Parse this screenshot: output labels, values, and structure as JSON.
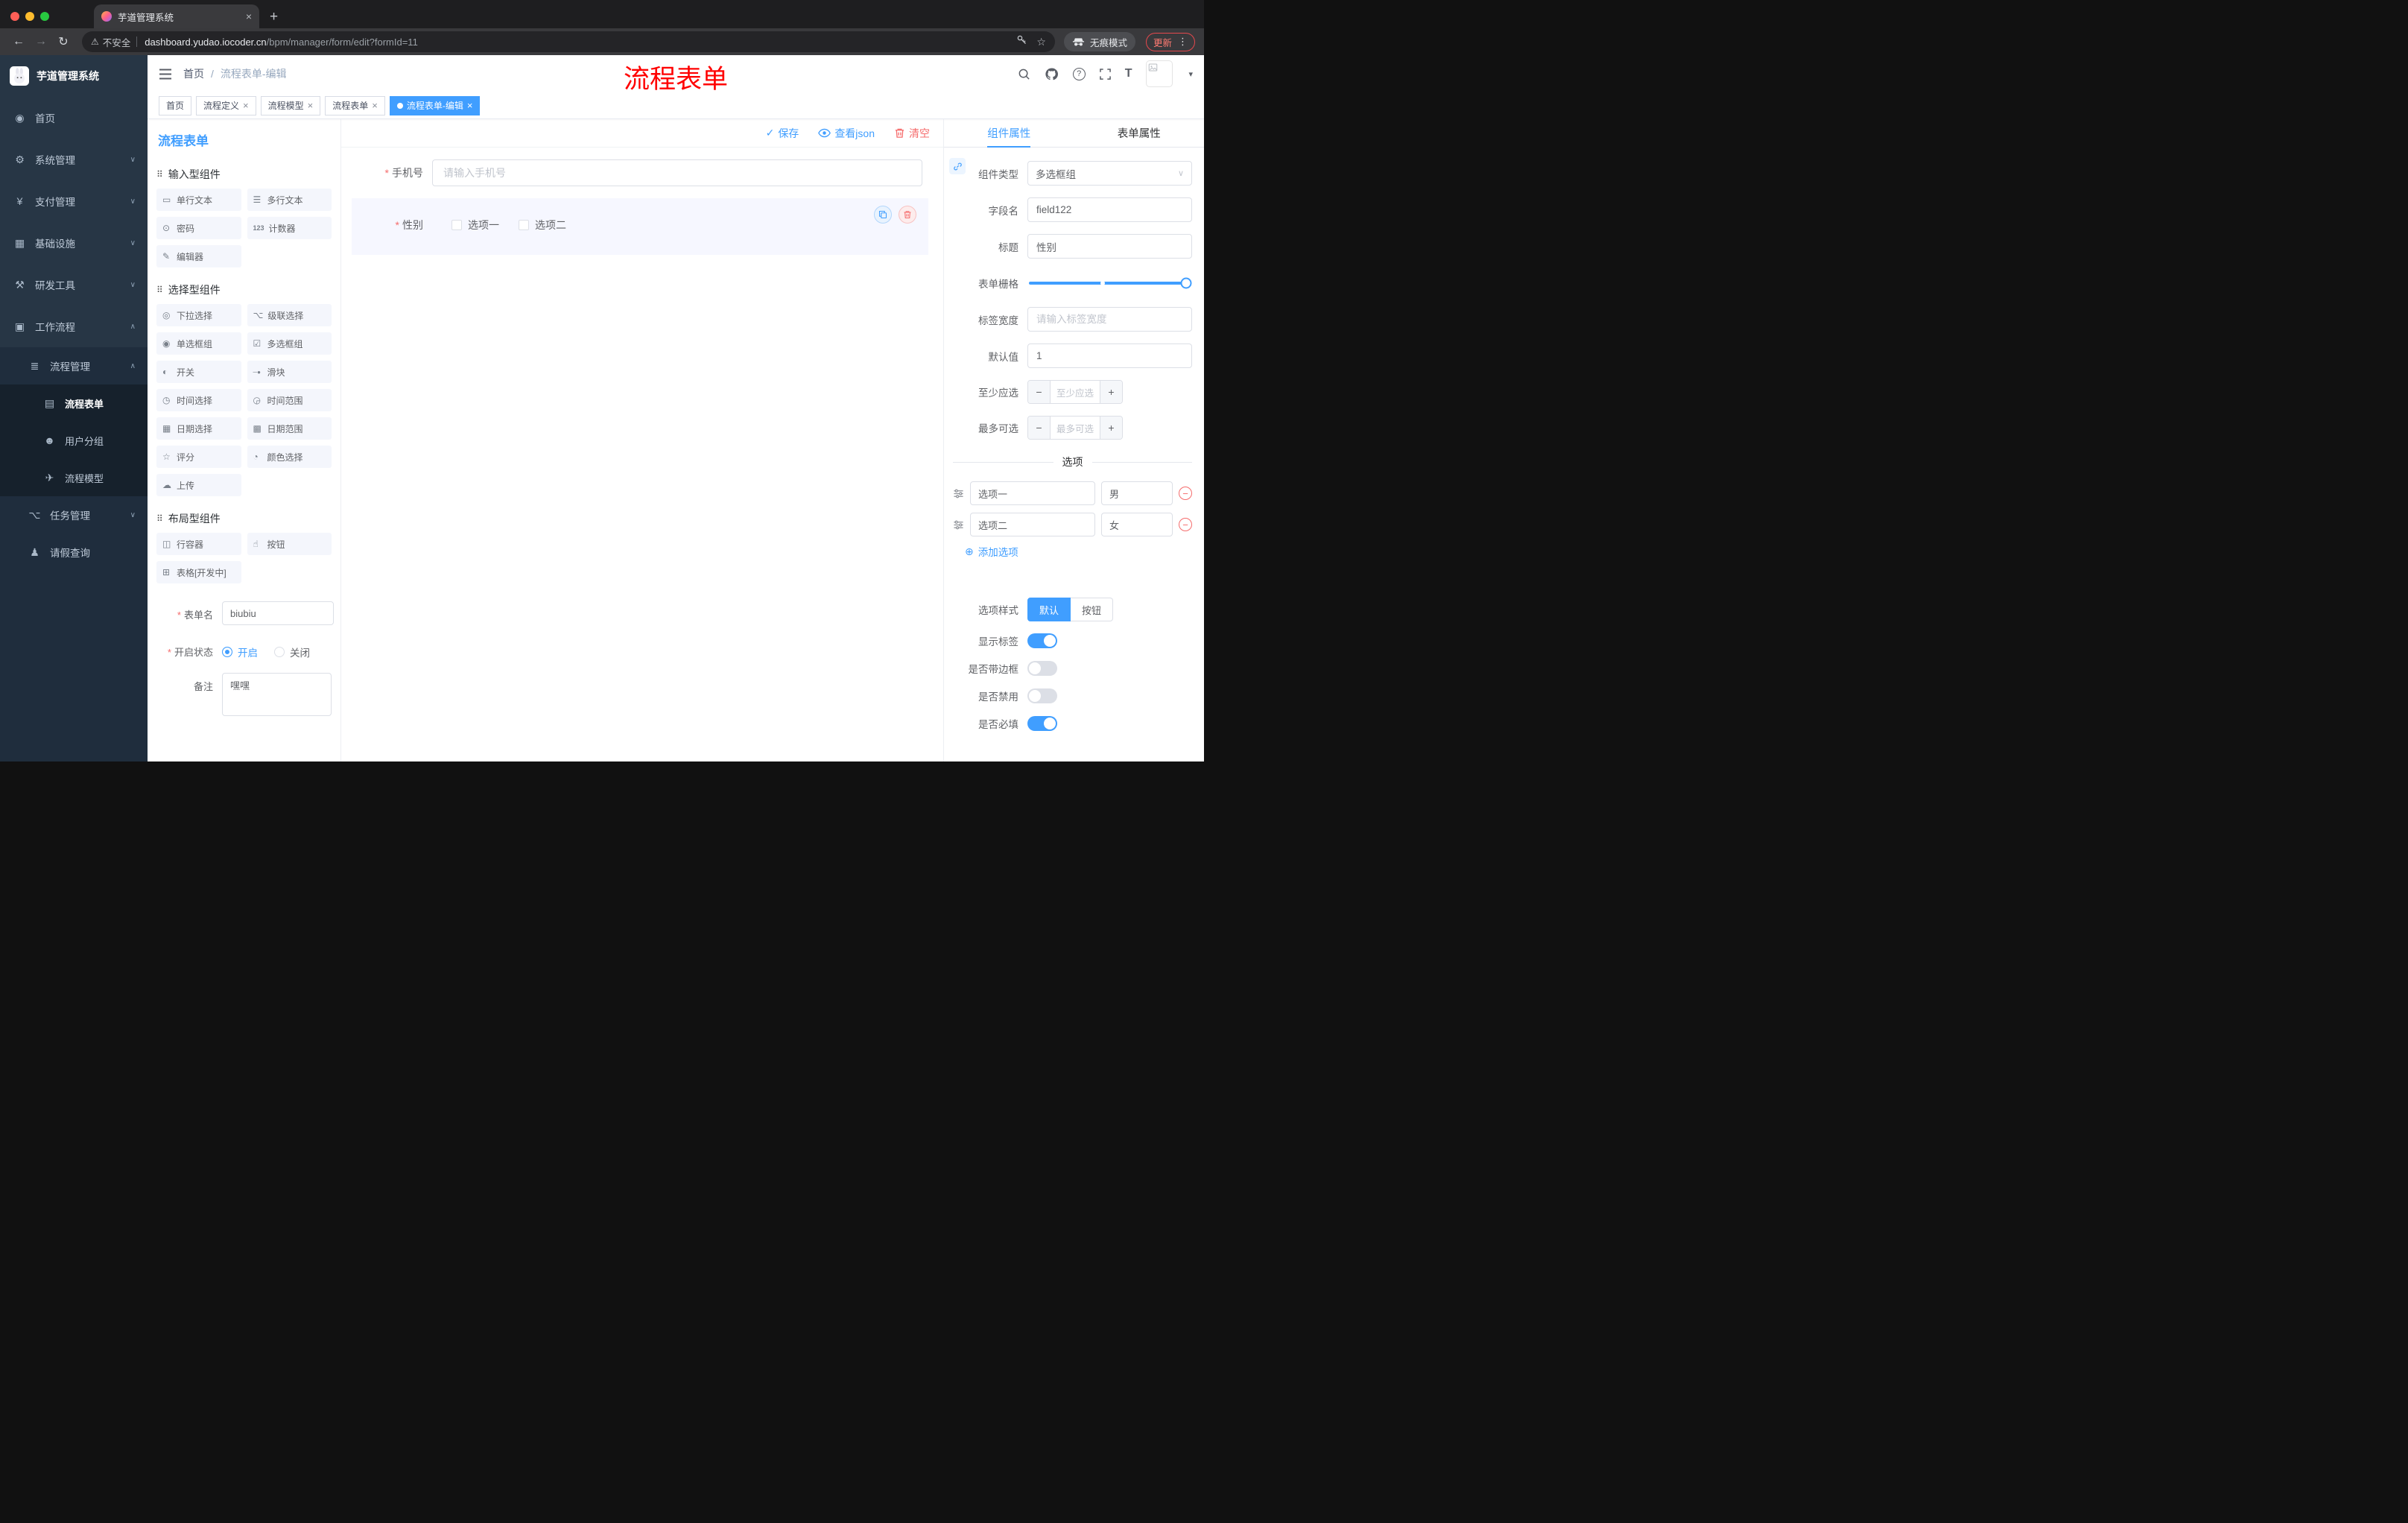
{
  "theme": {
    "primary": "#409eff",
    "danger": "#f56c6c",
    "annotation_color": "#ff0000",
    "sidebar_bg": "#273645"
  },
  "icons": {
    "back": "←",
    "forward": "→",
    "reload": "↻",
    "warning": "⚠",
    "star": "☆",
    "menu_dots": "⋮",
    "new_tab": "+",
    "close": "×",
    "caret_down": "▾",
    "check": "✓",
    "select_caret": "∨",
    "plus_circle": "⊕",
    "minus": "−",
    "plus": "+",
    "help": "?",
    "font_size": "T"
  },
  "browser": {
    "tab_title": "芋道管理系统",
    "security": "不安全",
    "url_host": "dashboard.yudao.iocoder.cn",
    "url_path": "/bpm/manager/form/edit?formId=11",
    "incognito": "无痕模式",
    "update": "更新"
  },
  "sidebar": {
    "logo": "芋道管理系统",
    "items": [
      {
        "icon": "◉",
        "label": "首页"
      },
      {
        "icon": "⚙",
        "label": "系统管理",
        "arrow": "∨"
      },
      {
        "icon": "¥",
        "label": "支付管理",
        "arrow": "∨"
      },
      {
        "icon": "▦",
        "label": "基础设施",
        "arrow": "∨"
      },
      {
        "icon": "⚒",
        "label": "研发工具",
        "arrow": "∨"
      },
      {
        "icon": "▣",
        "label": "工作流程",
        "arrow": "∧"
      },
      {
        "icon": "≣",
        "label": "流程管理",
        "arrow": "∧"
      },
      {
        "icon": "▤",
        "label": "流程表单"
      },
      {
        "icon": "☻",
        "label": "用户分组"
      },
      {
        "icon": "✈",
        "label": "流程模型"
      },
      {
        "icon": "⌥",
        "label": "任务管理",
        "arrow": "∨"
      },
      {
        "icon": "♟",
        "label": "请假查询"
      }
    ]
  },
  "navbar": {
    "breadcrumb_home": "首页",
    "breadcrumb_sep": "/",
    "breadcrumb_current": "流程表单-编辑",
    "annotation": "流程表单"
  },
  "tags": [
    {
      "label": "首页"
    },
    {
      "label": "流程定义",
      "close": "×"
    },
    {
      "label": "流程模型",
      "close": "×"
    },
    {
      "label": "流程表单",
      "close": "×"
    },
    {
      "label": "流程表单-编辑",
      "close": "×",
      "active": true
    }
  ],
  "palette": {
    "title": "流程表单",
    "sections": [
      {
        "icon": "⠿",
        "title": "输入型组件",
        "items": [
          {
            "icon": "▭",
            "label": "单行文本"
          },
          {
            "icon": "☰",
            "label": "多行文本"
          },
          {
            "icon": "⊙",
            "label": "密码"
          },
          {
            "icon": "123",
            "label": "计数器"
          },
          {
            "icon": "✎",
            "label": "编辑器"
          }
        ]
      },
      {
        "icon": "⠿",
        "title": "选择型组件",
        "items": [
          {
            "icon": "◎",
            "label": "下拉选择"
          },
          {
            "icon": "⌥",
            "label": "级联选择"
          },
          {
            "icon": "◉",
            "label": "单选框组"
          },
          {
            "icon": "☑",
            "label": "多选框组"
          },
          {
            "icon": "◐",
            "label": "开关"
          },
          {
            "icon": "─●",
            "label": "滑块"
          },
          {
            "icon": "◷",
            "label": "时间选择"
          },
          {
            "icon": "◶",
            "label": "时间范围"
          },
          {
            "icon": "▦",
            "label": "日期选择"
          },
          {
            "icon": "▩",
            "label": "日期范围"
          },
          {
            "icon": "☆",
            "label": "评分"
          },
          {
            "icon": "◔",
            "label": "颜色选择"
          },
          {
            "icon": "☁",
            "label": "上传"
          }
        ]
      },
      {
        "icon": "⠿",
        "title": "布局型组件",
        "items": [
          {
            "icon": "◫",
            "label": "行容器"
          },
          {
            "icon": "☝",
            "label": "按钮"
          },
          {
            "icon": "⊞",
            "label": "表格[开发中]"
          }
        ]
      }
    ],
    "form": {
      "name_label": "表单名",
      "name_value": "biubiu",
      "status_label": "开启状态",
      "status_on": "开启",
      "status_off": "关闭",
      "status_checked": "开启",
      "remark_label": "备注",
      "remark_value": "嘿嘿"
    }
  },
  "canvas": {
    "save": "保存",
    "view_json": "查看json",
    "clear": "清空",
    "phone_label": "手机号",
    "phone_placeholder": "请输入手机号",
    "gender_label": "性别",
    "gender_opt1": "选项一",
    "gender_opt2": "选项二"
  },
  "props": {
    "tab_component": "组件属性",
    "tab_form": "表单属性",
    "type_label": "组件类型",
    "type_value": "多选框组",
    "field_label": "字段名",
    "field_value": "field122",
    "title_label": "标题",
    "title_value": "性别",
    "grid_label": "表单栅格",
    "labelwidth_label": "标签宽度",
    "labelwidth_placeholder": "请输入标签宽度",
    "default_label": "默认值",
    "default_value": "1",
    "min_label": "至少应选",
    "min_placeholder": "至少应选",
    "max_label": "最多可选",
    "max_placeholder": "最多可选",
    "options_divider": "选项",
    "options": [
      {
        "label": "选项一",
        "value": "男"
      },
      {
        "label": "选项二",
        "value": "女"
      }
    ],
    "add_option": "添加选项",
    "style_label": "选项样式",
    "style_default": "默认",
    "style_button": "按钮",
    "show_label": "显示标签",
    "border_label": "是否带边框",
    "disabled_label": "是否禁用",
    "required_label": "是否必填",
    "switches": {
      "show_label": true,
      "border": false,
      "disabled": false,
      "required": true
    }
  }
}
